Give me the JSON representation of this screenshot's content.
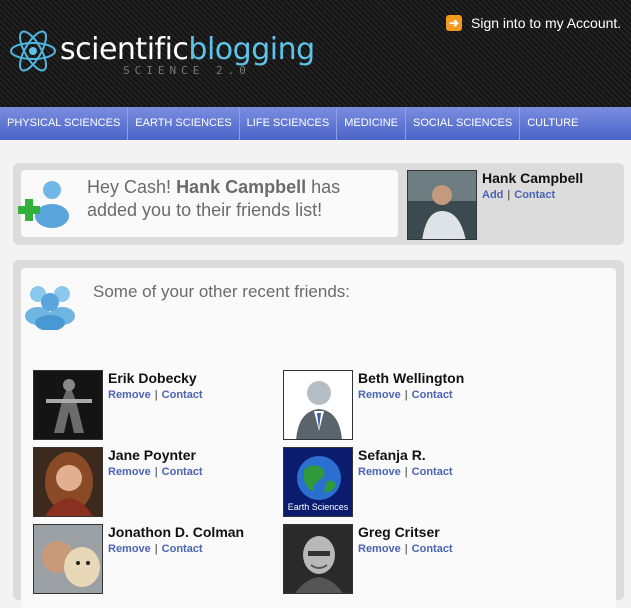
{
  "header": {
    "logo_main": "scientific",
    "logo_accent": "blogging",
    "logo_tagline": "SCIENCE 2.0",
    "signin_label": "Sign into to my Account."
  },
  "nav": {
    "items": [
      "PHYSICAL SCIENCES",
      "EARTH SCIENCES",
      "LIFE SCIENCES",
      "MEDICINE",
      "SOCIAL SCIENCES",
      "CULTURE"
    ]
  },
  "notification": {
    "greeting": "Hey Cash!",
    "name": "Hank Campbell",
    "message": "has added you to their friends list!",
    "profile_name": "Hank Campbell",
    "add_label": "Add",
    "contact_label": "Contact"
  },
  "recent": {
    "heading": "Some of your other recent friends:",
    "friends": [
      {
        "name": "Erik Dobecky",
        "remove": "Remove",
        "contact": "Contact"
      },
      {
        "name": "Beth Wellington",
        "remove": "Remove",
        "contact": "Contact"
      },
      {
        "name": "Jane Poynter",
        "remove": "Remove",
        "contact": "Contact"
      },
      {
        "name": "Sefanja R.",
        "remove": "Remove",
        "contact": "Contact",
        "avatar_caption": "Earth Sciences"
      },
      {
        "name": "Jonathon D. Colman",
        "remove": "Remove",
        "contact": "Contact"
      },
      {
        "name": "Greg Critser",
        "remove": "Remove",
        "contact": "Contact"
      }
    ]
  },
  "colors": {
    "nav_blue": "#5a72d0",
    "link_blue": "#4b64b4",
    "accent_orange": "#f29a1f",
    "logo_cyan": "#5fc2e8"
  }
}
